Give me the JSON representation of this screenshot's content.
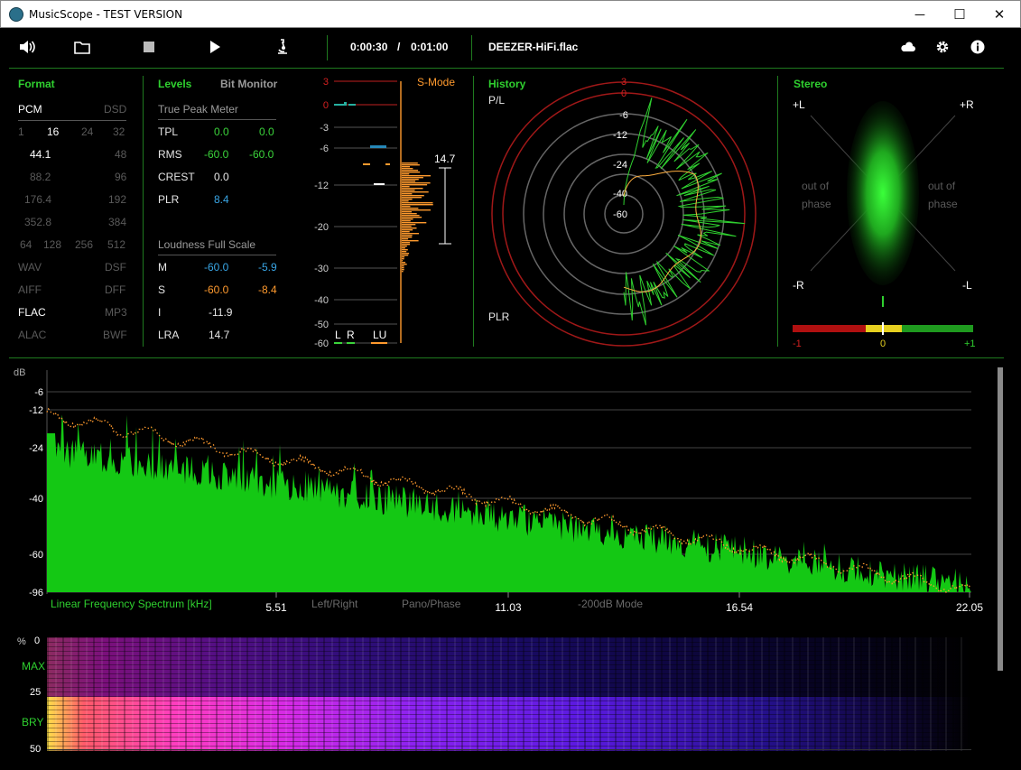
{
  "window": {
    "title": "MusicScope - TEST VERSION",
    "minimize": "─",
    "maximize": "☐",
    "close": "✕"
  },
  "toolbar": {
    "time_current": "0:00:30",
    "time_sep": "/",
    "time_total": "0:01:00",
    "file_name": "DEEZER-HiFi.flac"
  },
  "format": {
    "heading": "Format",
    "pcm": "PCM",
    "dsd": "DSD",
    "bitdepths": [
      "1",
      "16",
      "24",
      "32"
    ],
    "rates_left": [
      "44.1",
      "88.2",
      "176.4",
      "352.8"
    ],
    "rates_right": [
      "48",
      "96",
      "192",
      "384"
    ],
    "dsd_rates": [
      "64",
      "128",
      "256",
      "512"
    ],
    "containers_left": [
      "WAV",
      "AIFF",
      "FLAC",
      "ALAC"
    ],
    "containers_right": [
      "DSF",
      "DFF",
      "MP3",
      "BWF"
    ]
  },
  "levels": {
    "heading": "Levels",
    "bit_monitor": "Bit Monitor",
    "true_peak_title": "True Peak Meter",
    "tpl_label": "TPL",
    "tpl_l": "0.0",
    "tpl_r": "0.0",
    "rms_label": "RMS",
    "rms_l": "-60.0",
    "rms_r": "-60.0",
    "crest_label": "CREST",
    "crest_val": "0.0",
    "plr_label": "PLR",
    "plr_val": "8.4",
    "loudness_title": "Loudness Full Scale",
    "m_label": "M",
    "m_l": "-60.0",
    "m_r": "-5.9",
    "s_label": "S",
    "s_l": "-60.0",
    "s_r": "-8.4",
    "i_label": "I",
    "i_val": "-11.9",
    "lra_label": "LRA",
    "lra_val": "14.7"
  },
  "meter": {
    "scale": [
      "3",
      "0",
      "-3",
      "-6",
      "-12",
      "-20",
      "-30",
      "-40",
      "-50",
      "-60"
    ],
    "smode": "S-Mode",
    "lra_marker": "14.7",
    "ch_l": "L",
    "ch_r": "R",
    "ch_lu": "LU"
  },
  "history": {
    "heading": "History",
    "top_label": "P/L",
    "bottom_label": "PLR",
    "ring_labels": [
      "3",
      "0",
      "-6",
      "-12",
      "-24",
      "-40",
      "-60"
    ]
  },
  "stereo": {
    "heading": "Stereo",
    "plus_l": "+L",
    "plus_r": "+R",
    "minus_r": "-R",
    "minus_l": "-L",
    "oop_left_1": "out of",
    "oop_left_2": "phase",
    "oop_right_1": "out of",
    "oop_right_2": "phase",
    "corr_minus": "-1",
    "corr_zero": "0",
    "corr_plus": "+1"
  },
  "spectrum": {
    "db_unit": "dB",
    "y_ticks": [
      "-6",
      "-12",
      "-24",
      "-40",
      "-60",
      "-96"
    ],
    "x_title": "Linear Frequency Spectrum [kHz]",
    "x_ticks": [
      "5.51",
      "11.03",
      "16.54",
      "22.05"
    ],
    "mode_left_right": "Left/Right",
    "mode_pano": "Pano/Phase",
    "mode_200db": "-200dB Mode"
  },
  "spectrogram": {
    "pct": "%",
    "y_ticks": [
      "0",
      "25",
      "50"
    ],
    "max_label": "MAX",
    "bry_label": "BRY"
  },
  "colors": {
    "accent_green": "#2fd02f",
    "separator": "#1f7a1f",
    "orange": "#ff9a2e",
    "red": "#d42020",
    "blue": "#39a6e6"
  }
}
